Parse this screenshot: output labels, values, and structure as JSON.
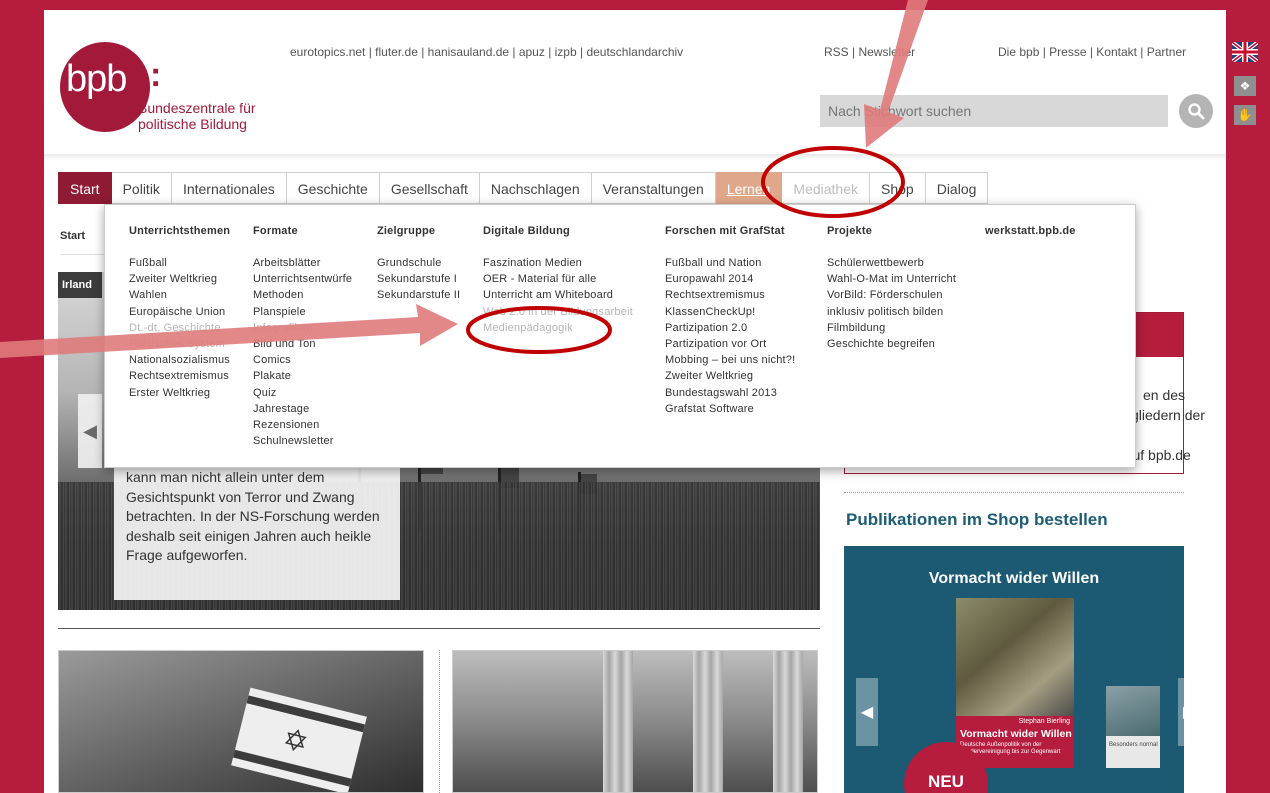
{
  "header": {
    "logo_text": "bpb",
    "logo_colon": ":",
    "logo_line1": "Bundeszentrale für",
    "logo_line2": "politische Bildung",
    "top_links": "eurotopics.net | fluter.de | hanisauland.de | apuz | izpb | deutschlandarchiv",
    "rss_links": "RSS | Newsletter",
    "corporate_links": "Die bpb | Presse | Kontakt | Partner",
    "search_placeholder": "Nach Stichwort suchen"
  },
  "nav": [
    {
      "label": "Start"
    },
    {
      "label": "Politik"
    },
    {
      "label": "Internationales"
    },
    {
      "label": "Geschichte"
    },
    {
      "label": "Gesellschaft"
    },
    {
      "label": "Nachschlagen"
    },
    {
      "label": "Veranstaltungen"
    },
    {
      "label": "Lernen"
    },
    {
      "label": "Mediathek"
    },
    {
      "label": "Shop"
    },
    {
      "label": "Dialog"
    }
  ],
  "breadcrumb": "Start",
  "hero": {
    "tab_label": "Irland",
    "text_line1": "kann man nicht allein unter dem",
    "text_line2": "Gesichtspunkt von Terror und Zwang",
    "text_line3": "betrachten. In der NS-Forschung werden",
    "text_line4": "deshalb seit einigen Jahren auch heikle",
    "text_line5": "Frage aufgeworfen."
  },
  "right_box": {
    "line1": "en des",
    "line2": "gliedern der",
    "line3": "a auf bpb.de"
  },
  "shop": {
    "title": "Publikationen im Shop bestellen",
    "book_title": "Vormacht wider Willen",
    "book_author": "Stephan Bierling",
    "book_name": "Vormacht wider Willen",
    "book_sub1": "Deutsche Außenpolitik von der",
    "book_sub2": "Wiedervereinigung bis zur Gegenwart",
    "book2_label": "Besonders normal",
    "badge": "NEU"
  },
  "dropdown": {
    "columns": [
      {
        "heading": "Unterrichtsthemen",
        "items": [
          "Fußball",
          "Zweiter Weltkrieg",
          "Wahlen",
          "Europäische Union",
          "Dt.-dt. Geschichte",
          "Politisches System",
          "Nationalsozialismus",
          "Rechtsextremismus",
          "Erster Weltkrieg"
        ]
      },
      {
        "heading": "Formate",
        "items": [
          "Arbeitsblätter",
          "Unterrichtsentwürfe",
          "Methoden",
          "Planspiele",
          "Infografiken",
          "Bild und Ton",
          "Comics",
          "Plakate",
          "Quiz",
          "Jahrestage",
          "Rezensionen",
          "Schulnewsletter"
        ]
      },
      {
        "heading": "Zielgruppe",
        "items": [
          "Grundschule",
          "Sekundarstufe I",
          "Sekundarstufe II"
        ]
      },
      {
        "heading": "Digitale Bildung",
        "items": [
          "Faszination Medien",
          "OER - Material für alle",
          "Unterricht am Whiteboard",
          "Web 2.0 in der Bildungsarbeit",
          "Medienpädagogik"
        ]
      },
      {
        "heading": "Forschen mit GrafStat",
        "items": [
          "Fußball und Nation",
          "Europawahl 2014",
          "Rechtsextremismus",
          "KlassenCheckUp!",
          "Partizipation 2.0",
          "Partizipation vor Ort",
          "Mobbing – bei uns nicht?!",
          "Zweiter Weltkrieg",
          "Bundestagswahl 2013",
          "Grafstat Software"
        ]
      },
      {
        "heading": "Projekte",
        "items": [
          "Schülerwettbewerb",
          "Wahl-O-Mat im Unterricht",
          "VorBild: Förderschulen",
          "inklusiv politisch bilden",
          "Filmbildung",
          "Geschichte begreifen"
        ]
      },
      {
        "heading": "werkstatt.bpb.de",
        "items": []
      }
    ]
  },
  "colors": {
    "brand": "#a3193a",
    "background": "#b51c3e",
    "annotation_arrow": "#e07b7b",
    "annotation_ring": "#c00000",
    "shop_blue": "#1c5a73"
  },
  "icons": [
    "search-icon",
    "uk-flag-icon",
    "sign-language-icon",
    "easy-language-icon",
    "chevron-left-icon",
    "chevron-right-icon"
  ]
}
